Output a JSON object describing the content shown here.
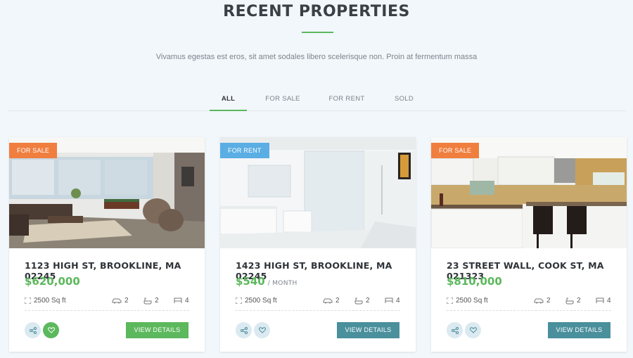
{
  "header": {
    "title": "RECENT PROPERTIES",
    "subtitle": "Vivamus egestas est eros, sit amet sodales libero scelerisque non. Proin at fermentum massa"
  },
  "tabs": [
    {
      "label": "ALL",
      "active": true
    },
    {
      "label": "FOR SALE",
      "active": false
    },
    {
      "label": "FOR RENT",
      "active": false
    },
    {
      "label": "SOLD",
      "active": false
    }
  ],
  "colors": {
    "accent_green": "#5cb85c",
    "badge_sale": "#f07e3e",
    "badge_rent": "#5aaee3",
    "teal": "#4a8f9c"
  },
  "cards": [
    {
      "badge": "FOR SALE",
      "address": "1123 HIGH ST, BROOKLINE, MA 02245",
      "price": "$620,000",
      "price_unit": "",
      "area": "2500 Sq ft",
      "garage": "2",
      "baths": "2",
      "beds": "4",
      "button": "VIEW DETAILS"
    },
    {
      "badge": "FOR RENT",
      "address": "1423 HIGH ST, BROOKLINE, MA 02245",
      "price": "$540",
      "price_unit": "/ MONTH",
      "area": "2500 Sq ft",
      "garage": "2",
      "baths": "2",
      "beds": "4",
      "button": "VIEW DETAILS"
    },
    {
      "badge": "FOR SALE",
      "address": "23 STREET WALL, COOK ST, MA 021323",
      "price": "$810,000",
      "price_unit": "",
      "area": "2500 Sq ft",
      "garage": "2",
      "baths": "2",
      "beds": "4",
      "button": "VIEW DETAILS"
    }
  ]
}
